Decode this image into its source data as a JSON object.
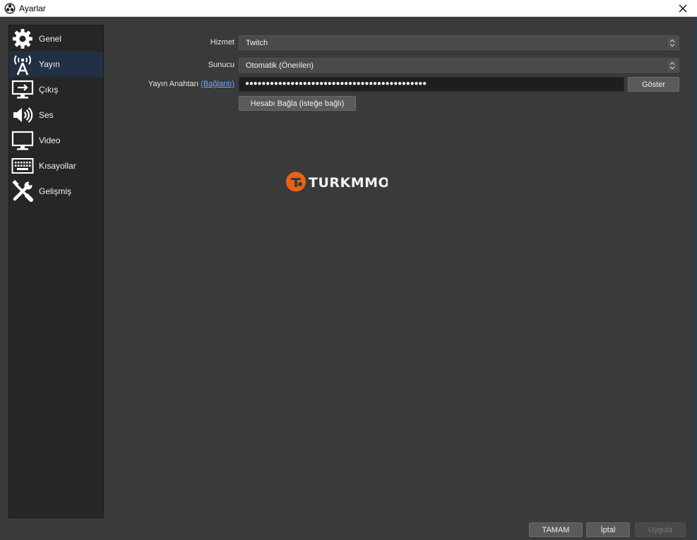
{
  "window": {
    "title": "Ayarlar"
  },
  "sidebar": {
    "items": [
      {
        "label": "Genel",
        "icon": "gear-icon"
      },
      {
        "label": "Yayın",
        "icon": "broadcast-antenna-icon",
        "active": true
      },
      {
        "label": "Çıkış",
        "icon": "output-monitor-icon"
      },
      {
        "label": "Ses",
        "icon": "speaker-icon"
      },
      {
        "label": "Video",
        "icon": "monitor-icon"
      },
      {
        "label": "Kısayollar",
        "icon": "keyboard-icon"
      },
      {
        "label": "Gelişmiş",
        "icon": "tools-icon"
      }
    ]
  },
  "stream": {
    "service_label": "Hizmet",
    "service_value": "Twitch",
    "server_label": "Sunucu",
    "server_value": "Otomatik (Önerilen)",
    "key_label": "Yayın Anahtarı",
    "key_link": "(Bağlantı)",
    "key_value": "●●●●●●●●●●●●●●●●●●●●●●●●●●●●●●●●●●●●●●●●●●●●",
    "show_button": "Göster",
    "connect_button": "Hesabı Bağla (isteğe bağlı)"
  },
  "watermark": {
    "text": "TURKMMO",
    "color": "#e8621a"
  },
  "footer": {
    "ok_button": "TAMAM",
    "cancel_button": "İptal",
    "apply_button": "Uygula"
  },
  "colors": {
    "accent_active": "#223045",
    "link": "#6ea8ff"
  }
}
